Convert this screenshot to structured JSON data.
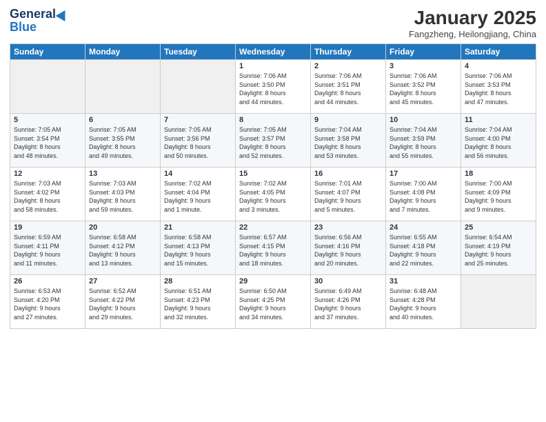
{
  "header": {
    "logo_general": "General",
    "logo_blue": "Blue",
    "month": "January 2025",
    "location": "Fangzheng, Heilongjiang, China"
  },
  "weekdays": [
    "Sunday",
    "Monday",
    "Tuesday",
    "Wednesday",
    "Thursday",
    "Friday",
    "Saturday"
  ],
  "weeks": [
    [
      {
        "day": "",
        "info": ""
      },
      {
        "day": "",
        "info": ""
      },
      {
        "day": "",
        "info": ""
      },
      {
        "day": "1",
        "info": "Sunrise: 7:06 AM\nSunset: 3:50 PM\nDaylight: 8 hours\nand 44 minutes."
      },
      {
        "day": "2",
        "info": "Sunrise: 7:06 AM\nSunset: 3:51 PM\nDaylight: 8 hours\nand 44 minutes."
      },
      {
        "day": "3",
        "info": "Sunrise: 7:06 AM\nSunset: 3:52 PM\nDaylight: 8 hours\nand 45 minutes."
      },
      {
        "day": "4",
        "info": "Sunrise: 7:06 AM\nSunset: 3:53 PM\nDaylight: 8 hours\nand 47 minutes."
      }
    ],
    [
      {
        "day": "5",
        "info": "Sunrise: 7:05 AM\nSunset: 3:54 PM\nDaylight: 8 hours\nand 48 minutes."
      },
      {
        "day": "6",
        "info": "Sunrise: 7:05 AM\nSunset: 3:55 PM\nDaylight: 8 hours\nand 49 minutes."
      },
      {
        "day": "7",
        "info": "Sunrise: 7:05 AM\nSunset: 3:56 PM\nDaylight: 8 hours\nand 50 minutes."
      },
      {
        "day": "8",
        "info": "Sunrise: 7:05 AM\nSunset: 3:57 PM\nDaylight: 8 hours\nand 52 minutes."
      },
      {
        "day": "9",
        "info": "Sunrise: 7:04 AM\nSunset: 3:58 PM\nDaylight: 8 hours\nand 53 minutes."
      },
      {
        "day": "10",
        "info": "Sunrise: 7:04 AM\nSunset: 3:59 PM\nDaylight: 8 hours\nand 55 minutes."
      },
      {
        "day": "11",
        "info": "Sunrise: 7:04 AM\nSunset: 4:00 PM\nDaylight: 8 hours\nand 56 minutes."
      }
    ],
    [
      {
        "day": "12",
        "info": "Sunrise: 7:03 AM\nSunset: 4:02 PM\nDaylight: 8 hours\nand 58 minutes."
      },
      {
        "day": "13",
        "info": "Sunrise: 7:03 AM\nSunset: 4:03 PM\nDaylight: 8 hours\nand 59 minutes."
      },
      {
        "day": "14",
        "info": "Sunrise: 7:02 AM\nSunset: 4:04 PM\nDaylight: 9 hours\nand 1 minute."
      },
      {
        "day": "15",
        "info": "Sunrise: 7:02 AM\nSunset: 4:05 PM\nDaylight: 9 hours\nand 3 minutes."
      },
      {
        "day": "16",
        "info": "Sunrise: 7:01 AM\nSunset: 4:07 PM\nDaylight: 9 hours\nand 5 minutes."
      },
      {
        "day": "17",
        "info": "Sunrise: 7:00 AM\nSunset: 4:08 PM\nDaylight: 9 hours\nand 7 minutes."
      },
      {
        "day": "18",
        "info": "Sunrise: 7:00 AM\nSunset: 4:09 PM\nDaylight: 9 hours\nand 9 minutes."
      }
    ],
    [
      {
        "day": "19",
        "info": "Sunrise: 6:59 AM\nSunset: 4:11 PM\nDaylight: 9 hours\nand 11 minutes."
      },
      {
        "day": "20",
        "info": "Sunrise: 6:58 AM\nSunset: 4:12 PM\nDaylight: 9 hours\nand 13 minutes."
      },
      {
        "day": "21",
        "info": "Sunrise: 6:58 AM\nSunset: 4:13 PM\nDaylight: 9 hours\nand 15 minutes."
      },
      {
        "day": "22",
        "info": "Sunrise: 6:57 AM\nSunset: 4:15 PM\nDaylight: 9 hours\nand 18 minutes."
      },
      {
        "day": "23",
        "info": "Sunrise: 6:56 AM\nSunset: 4:16 PM\nDaylight: 9 hours\nand 20 minutes."
      },
      {
        "day": "24",
        "info": "Sunrise: 6:55 AM\nSunset: 4:18 PM\nDaylight: 9 hours\nand 22 minutes."
      },
      {
        "day": "25",
        "info": "Sunrise: 6:54 AM\nSunset: 4:19 PM\nDaylight: 9 hours\nand 25 minutes."
      }
    ],
    [
      {
        "day": "26",
        "info": "Sunrise: 6:53 AM\nSunset: 4:20 PM\nDaylight: 9 hours\nand 27 minutes."
      },
      {
        "day": "27",
        "info": "Sunrise: 6:52 AM\nSunset: 4:22 PM\nDaylight: 9 hours\nand 29 minutes."
      },
      {
        "day": "28",
        "info": "Sunrise: 6:51 AM\nSunset: 4:23 PM\nDaylight: 9 hours\nand 32 minutes."
      },
      {
        "day": "29",
        "info": "Sunrise: 6:50 AM\nSunset: 4:25 PM\nDaylight: 9 hours\nand 34 minutes."
      },
      {
        "day": "30",
        "info": "Sunrise: 6:49 AM\nSunset: 4:26 PM\nDaylight: 9 hours\nand 37 minutes."
      },
      {
        "day": "31",
        "info": "Sunrise: 6:48 AM\nSunset: 4:28 PM\nDaylight: 9 hours\nand 40 minutes."
      },
      {
        "day": "",
        "info": ""
      }
    ]
  ]
}
